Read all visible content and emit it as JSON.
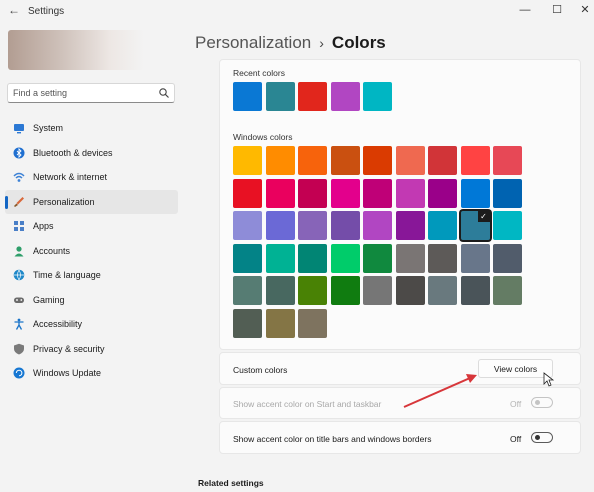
{
  "window": {
    "title": "Settings",
    "back_glyph": "←",
    "min_glyph": "—",
    "max_glyph": "☐",
    "close_glyph": "✕"
  },
  "search": {
    "placeholder": "Find a setting",
    "icon": "search-icon"
  },
  "sidebar": {
    "items": [
      {
        "label": "System",
        "icon": "system-icon",
        "color": "#2b78d4",
        "active": false
      },
      {
        "label": "Bluetooth & devices",
        "icon": "bluetooth-icon",
        "color": "#1f6fd0",
        "active": false
      },
      {
        "label": "Network & internet",
        "icon": "wifi-icon",
        "color": "#3d82d6",
        "active": false
      },
      {
        "label": "Personalization",
        "icon": "brush-icon",
        "color": "#d9683a",
        "active": true
      },
      {
        "label": "Apps",
        "icon": "apps-icon",
        "color": "#4a7fc7",
        "active": false
      },
      {
        "label": "Accounts",
        "icon": "person-icon",
        "color": "#2e9e6a",
        "active": false
      },
      {
        "label": "Time & language",
        "icon": "globe-clock-icon",
        "color": "#1e88c8",
        "active": false
      },
      {
        "label": "Gaming",
        "icon": "gamepad-icon",
        "color": "#6b6b6b",
        "active": false
      },
      {
        "label": "Accessibility",
        "icon": "accessibility-icon",
        "color": "#1a74c9",
        "active": false
      },
      {
        "label": "Privacy & security",
        "icon": "shield-icon",
        "color": "#7a7a7a",
        "active": false
      },
      {
        "label": "Windows Update",
        "icon": "update-icon",
        "color": "#1677d2",
        "active": false
      }
    ]
  },
  "header": {
    "parent": "Personalization",
    "separator": "›",
    "current": "Colors"
  },
  "recent": {
    "label": "Recent colors",
    "colors": [
      "#0a78d4",
      "#2a8693",
      "#e1261c",
      "#b146c2",
      "#00b6c3"
    ]
  },
  "windows_colors": {
    "label": "Windows colors",
    "selected_index": 25,
    "check_glyph": "✓",
    "colors": [
      "#ffb900",
      "#ff8c00",
      "#f7630c",
      "#ca5010",
      "#da3b01",
      "#ef6950",
      "#d13438",
      "#ff4343",
      "#e74856",
      "#e81123",
      "#ea005e",
      "#c30052",
      "#e3008c",
      "#bf0077",
      "#c239b3",
      "#9a0089",
      "#0078d7",
      "#0063b1",
      "#8e8cd8",
      "#6b69d6",
      "#8764b8",
      "#744da9",
      "#b146c2",
      "#881798",
      "#0099bc",
      "#2d7d9a",
      "#00b7c3",
      "#038387",
      "#00b294",
      "#018574",
      "#00cc6a",
      "#10893e",
      "#7a7574",
      "#5d5a58",
      "#68768a",
      "#515c6b",
      "#567c73",
      "#486860",
      "#498205",
      "#107c10",
      "#767676",
      "#4c4a48",
      "#69797e",
      "#4a5459",
      "#647c64",
      "#525e54",
      "#847545",
      "#7e735f"
    ]
  },
  "custom_colors": {
    "label": "Custom colors",
    "button": "View colors"
  },
  "accent_start": {
    "label": "Show accent color on Start and taskbar",
    "state": "Off",
    "enabled": false
  },
  "accent_title": {
    "label": "Show accent color on title bars and windows borders",
    "state": "Off",
    "enabled": true
  },
  "related": {
    "label": "Related settings"
  },
  "annotation": {
    "arrow_color": "#d7363a"
  }
}
